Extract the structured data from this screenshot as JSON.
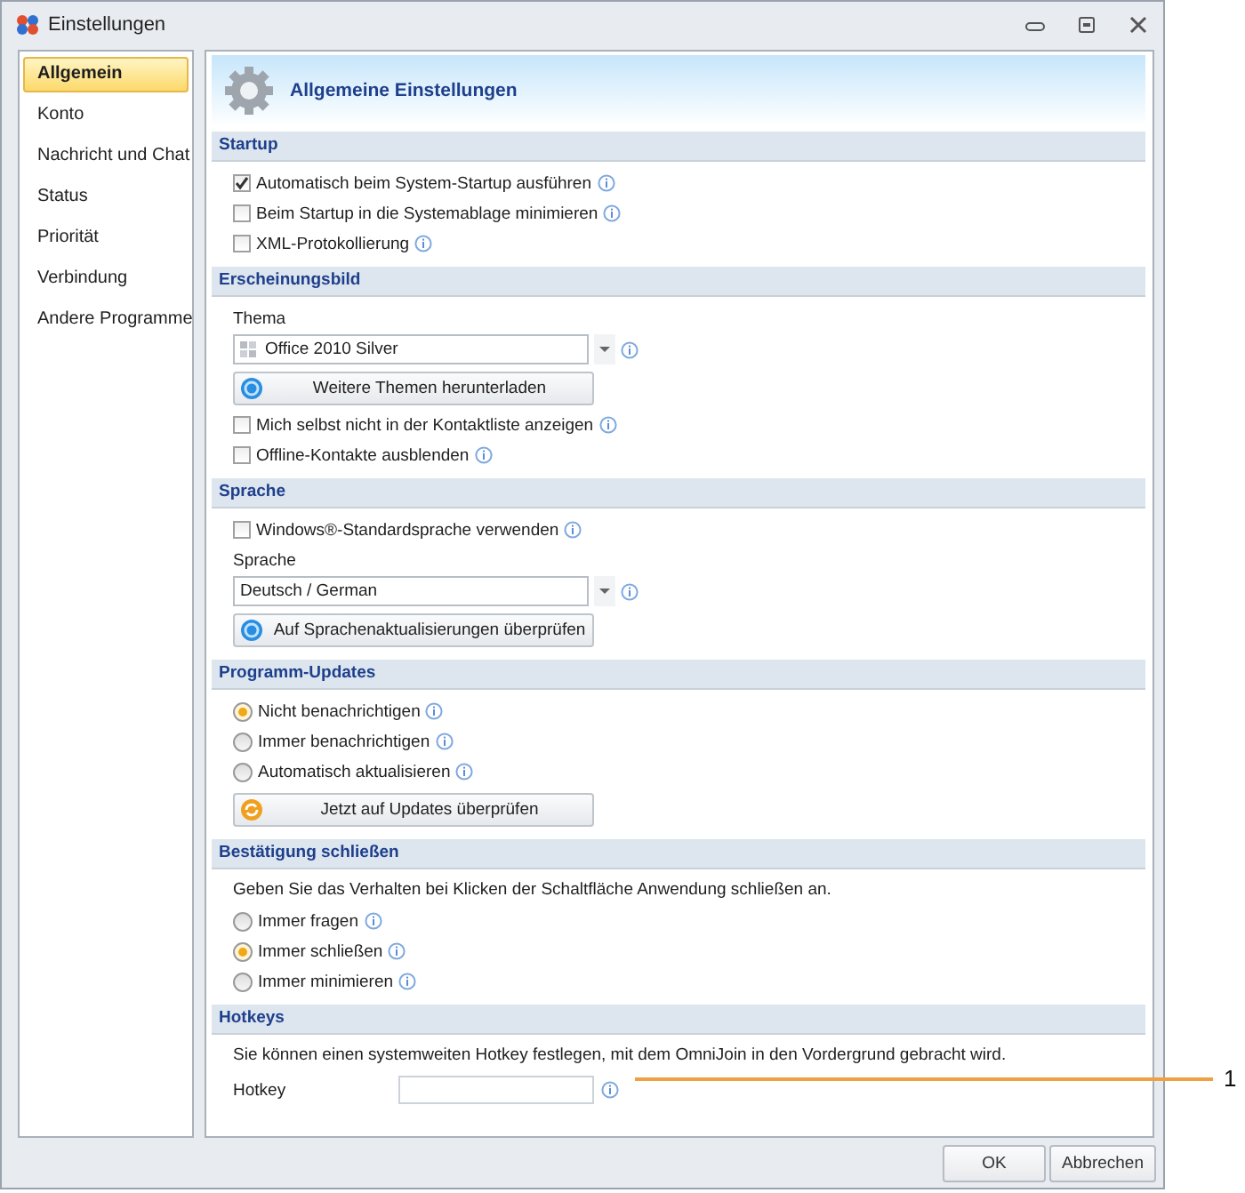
{
  "window": {
    "title": "Einstellungen"
  },
  "sidebar": {
    "items": [
      {
        "label": "Allgemein",
        "selected": true
      },
      {
        "label": "Konto",
        "selected": false
      },
      {
        "label": "Nachricht und Chat",
        "selected": false
      },
      {
        "label": "Status",
        "selected": false
      },
      {
        "label": "Priorität",
        "selected": false
      },
      {
        "label": "Verbindung",
        "selected": false
      },
      {
        "label": "Andere Programme",
        "selected": false
      }
    ]
  },
  "page_title": "Allgemeine Einstellungen",
  "sections": [
    {
      "title": "Startup",
      "items": [
        {
          "kind": "checkbox",
          "label": "Automatisch beim System-Startup ausführen",
          "checked": true
        },
        {
          "kind": "checkbox",
          "label": "Beim Startup in die Systemablage minimieren",
          "checked": false
        },
        {
          "kind": "checkbox",
          "label": "XML-Protokollierung",
          "checked": false
        }
      ]
    },
    {
      "title": "Erscheinungsbild",
      "items": [
        {
          "kind": "dropdown",
          "label": "Thema",
          "value": "Office 2010 Silver"
        },
        {
          "kind": "button",
          "label": "Weitere Themen herunterladen"
        },
        {
          "kind": "checkbox",
          "label": "Mich selbst nicht in der Kontaktliste anzeigen",
          "checked": false
        },
        {
          "kind": "checkbox",
          "label": "Offline-Kontakte ausblenden",
          "checked": false
        }
      ]
    },
    {
      "title": "Sprache",
      "items": [
        {
          "kind": "checkbox",
          "label": "Windows®-Standardsprache verwenden",
          "checked": false
        },
        {
          "kind": "dropdown",
          "label": "Sprache",
          "value": "Deutsch / German"
        },
        {
          "kind": "button",
          "label": "Auf Sprachenaktualisierungen überprüfen"
        }
      ]
    },
    {
      "title": "Programm-Updates",
      "items": [
        {
          "kind": "radio",
          "label": "Nicht benachrichtigen",
          "selected": true
        },
        {
          "kind": "radio",
          "label": "Immer benachrichtigen",
          "selected": false
        },
        {
          "kind": "radio",
          "label": "Automatisch aktualisieren",
          "selected": false
        },
        {
          "kind": "button",
          "label": "Jetzt auf Updates überprüfen"
        }
      ]
    },
    {
      "title": "Bestätigung schließen",
      "items": [
        {
          "kind": "text",
          "label": "Geben Sie das Verhalten bei Klicken der Schaltfläche Anwendung schließen an."
        },
        {
          "kind": "radio",
          "label": "Immer fragen",
          "selected": false
        },
        {
          "kind": "radio",
          "label": "Immer schließen",
          "selected": true
        },
        {
          "kind": "radio",
          "label": "Immer minimieren",
          "selected": false
        }
      ]
    },
    {
      "title": "Hotkeys",
      "items": [
        {
          "kind": "text",
          "label": "Sie können einen systemweiten Hotkey festlegen, mit dem OmniJoin in den Vordergrund gebracht wird."
        },
        {
          "kind": "field",
          "label": "Hotkey"
        }
      ]
    }
  ],
  "buttons": [
    {
      "label": "OK"
    },
    {
      "label": "Abbrechen"
    }
  ],
  "callout": {
    "label": "1"
  }
}
